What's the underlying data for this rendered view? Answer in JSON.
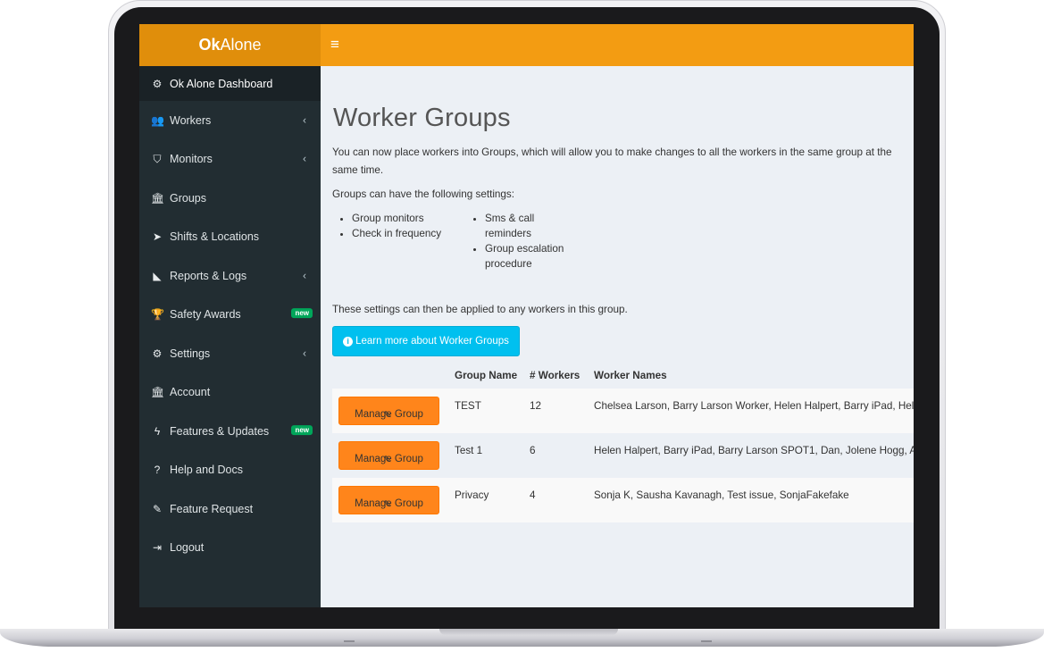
{
  "app": {
    "logo_bold": "Ok",
    "logo_rest": "Alone",
    "menu_toggle": "≡"
  },
  "sidebar": {
    "items": [
      {
        "label": "Ok Alone Dashboard",
        "icon": "dashboard-icon",
        "glyph": "⚙",
        "chevron": "",
        "badge": ""
      },
      {
        "label": "Workers",
        "icon": "users-icon",
        "glyph": "👥",
        "chevron": "‹",
        "badge": ""
      },
      {
        "label": "Monitors",
        "icon": "shield-icon",
        "glyph": "⛉",
        "chevron": "‹",
        "badge": ""
      },
      {
        "label": "Groups",
        "icon": "institution-icon",
        "glyph": "🏛",
        "chevron": "",
        "badge": ""
      },
      {
        "label": "Shifts & Locations",
        "icon": "location-arrow-icon",
        "glyph": "➤",
        "chevron": "",
        "badge": ""
      },
      {
        "label": "Reports & Logs",
        "icon": "area-chart-icon",
        "glyph": "◣",
        "chevron": "‹",
        "badge": ""
      },
      {
        "label": "Safety Awards",
        "icon": "trophy-icon",
        "glyph": "🏆",
        "chevron": "",
        "badge": "new"
      },
      {
        "label": "Settings",
        "icon": "cogs-icon",
        "glyph": "⚙",
        "chevron": "‹",
        "badge": ""
      },
      {
        "label": "Account",
        "icon": "institution-icon",
        "glyph": "🏛",
        "chevron": "",
        "badge": ""
      },
      {
        "label": "Features & Updates",
        "icon": "bolt-icon",
        "glyph": "ϟ",
        "chevron": "",
        "badge": "new"
      },
      {
        "label": "Help and Docs",
        "icon": "question-circle-icon",
        "glyph": "?",
        "chevron": "",
        "badge": ""
      },
      {
        "label": "Feature Request",
        "icon": "magic-wand-icon",
        "glyph": "✎",
        "chevron": "",
        "badge": ""
      },
      {
        "label": "Logout",
        "icon": "sign-out-icon",
        "glyph": "⇥",
        "chevron": "",
        "badge": ""
      }
    ]
  },
  "main": {
    "title": "Worker Groups",
    "intro": "You can now place workers into Groups, which will allow you to make changes to all the workers in the same group at the same time.",
    "settings_intro": "Groups can have the following settings:",
    "settings": [
      "Group monitors",
      "Check in frequency",
      "Sms & call reminders",
      "Group escalation procedure"
    ],
    "apply_text": "These settings can then be applied to any workers in this group.",
    "learn_more_label": "Learn more about Worker Groups",
    "table": {
      "headers": {
        "name": "Group Name",
        "count": "# Workers",
        "workers": "Worker Names"
      },
      "manage_label": "Manage Group",
      "rows": [
        {
          "name": "TEST",
          "count": "12",
          "workers": "Chelsea Larson, Barry Larson Worker, Helen Halpert, Barry iPad, Hele"
        },
        {
          "name": "Test 1",
          "count": "6",
          "workers": "Helen Halpert, Barry iPad, Barry Larson SPOT1, Dan, Jolene Hogg, An"
        },
        {
          "name": "Privacy",
          "count": "4",
          "workers": "Sonja K, Sausha Kavanagh, Test issue, SonjaFakefake"
        }
      ]
    }
  },
  "colors": {
    "header": "#f39c12",
    "logo_bg": "#e08e0b",
    "sidebar": "#222d32",
    "info_button": "#00c0ef",
    "manage_button": "#ff851b",
    "badge": "#00a65a"
  }
}
